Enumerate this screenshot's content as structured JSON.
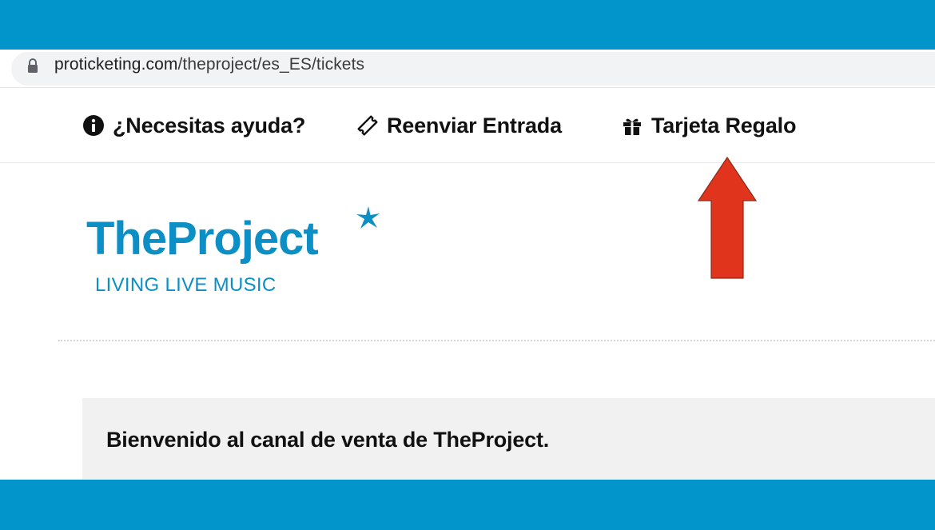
{
  "browser": {
    "url_domain": "proticketing.com",
    "url_path": "/theproject/es_ES/tickets"
  },
  "nav": {
    "items": [
      {
        "label": "¿Necesitas ayuda?",
        "icon": "info-icon"
      },
      {
        "label": "Reenviar Entrada",
        "icon": "ticket-icon"
      },
      {
        "label": "Tarjeta Regalo",
        "icon": "gift-icon"
      }
    ]
  },
  "logo": {
    "wordmark": "TheProject",
    "tagline": "LIVING LIVE MUSIC"
  },
  "welcome": {
    "text": "Bienvenido al canal de venta de TheProject."
  },
  "colors": {
    "brand_blue": "#0295cc",
    "logo_blue": "#0b8fc5",
    "arrow_red": "#e0341c"
  }
}
